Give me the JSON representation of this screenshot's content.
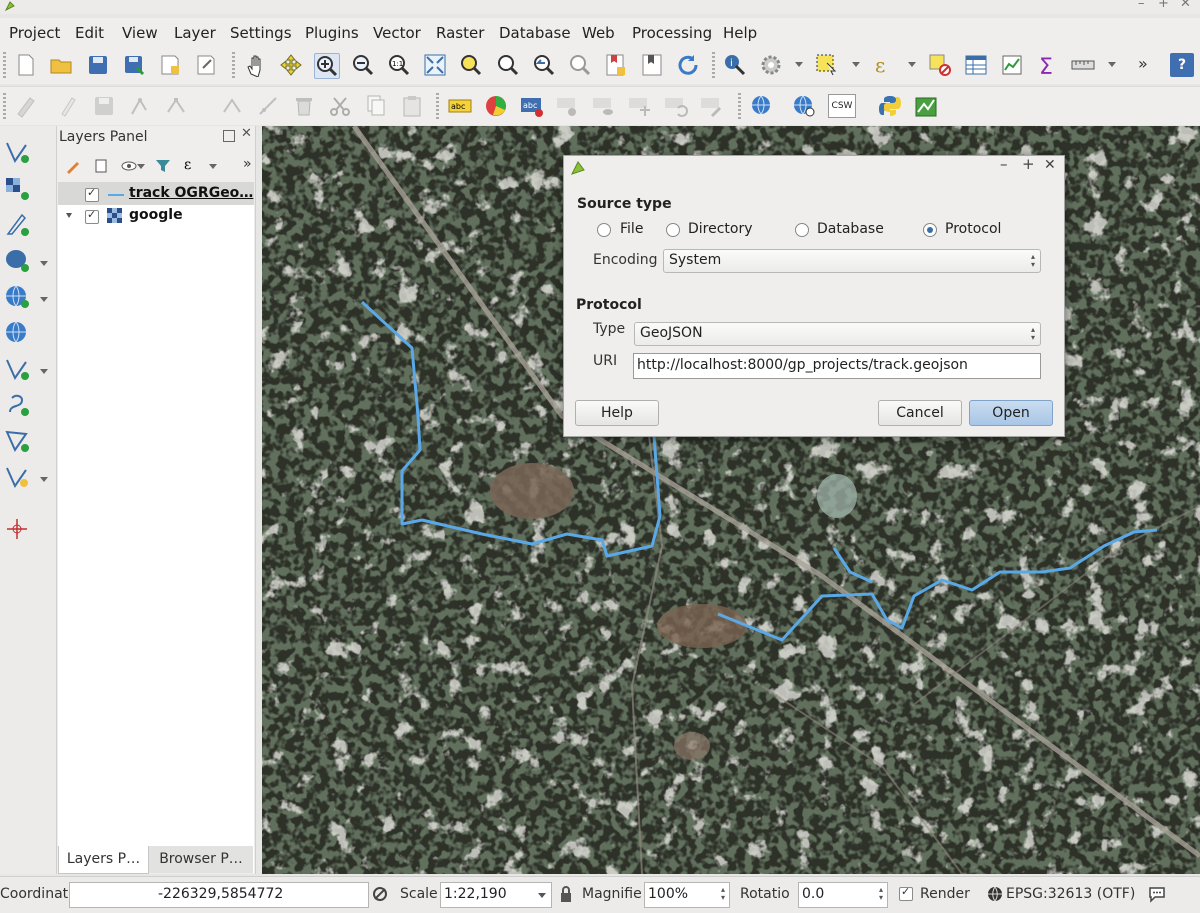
{
  "window": {
    "minimize": "–",
    "restore": "+",
    "close": "✕"
  },
  "menu": [
    "Project",
    "Edit",
    "View",
    "Layer",
    "Settings",
    "Plugins",
    "Vector",
    "Raster",
    "Database",
    "Web",
    "Processing",
    "Help"
  ],
  "toolbar1": {
    "icons": [
      "new-project-icon",
      "open-project-icon",
      "save-project-icon",
      "save-as-icon",
      "new-print-composer-icon",
      "composer-manager-icon",
      "pan-icon",
      "pan-to-selection-icon",
      "zoom-in-icon",
      "zoom-out-icon",
      "zoom-actual-icon",
      "zoom-full-icon",
      "zoom-to-selection-icon",
      "zoom-to-layer-icon",
      "zoom-last-icon",
      "zoom-next-icon",
      "new-bookmark-icon",
      "show-bookmarks-icon",
      "refresh-icon",
      "identify-icon",
      "action-icon",
      "select-feature-icon",
      "expression-select-icon",
      "deselect-icon",
      "attribute-table-icon",
      "field-calculator-icon",
      "statistics-icon",
      "measure-icon"
    ],
    "more": "»",
    "help": "?"
  },
  "toolbar2": {
    "icons": [
      "current-edits-icon",
      "toggle-editing-icon",
      "save-edits-icon",
      "add-feature-icon",
      "node-tool-icon",
      "move-feature-icon",
      "delete-selected-icon",
      "cut-features-icon",
      "copy-features-icon",
      "paste-features-icon",
      "label-icon",
      "diagram-icon",
      "layer-labeling-icon",
      "pin-labels-icon",
      "show-hide-labels-icon",
      "move-label-icon",
      "rotate-label-icon",
      "change-label-icon",
      "wms-layer-icon",
      "wfs-layer-icon",
      "csw-icon",
      "python-console-icon",
      "image-plugin-icon"
    ],
    "csw_text": "CSW",
    "abc_text": "abc"
  },
  "left_tools": [
    "add-vector-layer-icon",
    "add-raster-layer-icon",
    "add-delimited-text-icon",
    "add-postgis-layer-icon",
    "add-wms-layer-icon",
    "add-wfs-layer-icon",
    "add-spatialite-layer-icon",
    "add-gps-layer-icon",
    "new-shapefile-icon",
    "new-spatialite-icon",
    "add-georeferencer-icon"
  ],
  "layers_panel": {
    "title": "Layers Panel",
    "layers": [
      {
        "name": "track OGRGeo…",
        "checked": true,
        "type": "line",
        "color": "#5aa9e6"
      },
      {
        "name": "google",
        "checked": true,
        "type": "raster",
        "expanded": true
      }
    ],
    "tabs": [
      "Layers P…",
      "Browser P…"
    ]
  },
  "dialog": {
    "source_type_label": "Source type",
    "source_types": [
      {
        "label": "File",
        "selected": false
      },
      {
        "label": "Directory",
        "selected": false
      },
      {
        "label": "Database",
        "selected": false
      },
      {
        "label": "Protocol",
        "selected": true
      }
    ],
    "encoding_label": "Encoding",
    "encoding_value": "System",
    "protocol_section": "Protocol",
    "type_label": "Type",
    "type_value": "GeoJSON",
    "uri_label": "URI",
    "uri_value": "http://localhost:8000/gp_projects/track.geojson",
    "buttons": {
      "help": "Help",
      "cancel": "Cancel",
      "open": "Open"
    },
    "window": {
      "minimize": "–",
      "restore": "+",
      "close": "✕"
    }
  },
  "status": {
    "coordinate_label": "Coordinate",
    "coordinate_value": "-226329,5854772",
    "scale_label": "Scale",
    "scale_value": "1:22,190",
    "magnifier_label": "Magnifie",
    "magnifier_value": "100%",
    "rotation_label": "Rotatio",
    "rotation_value": "0.0",
    "render_label": "Render",
    "render_checked": true,
    "crs": "EPSG:32613 (OTF)"
  },
  "colors": {
    "track": "#5aa9e6",
    "accent": "#3a6ea8",
    "imagery": "#2b2f27"
  }
}
